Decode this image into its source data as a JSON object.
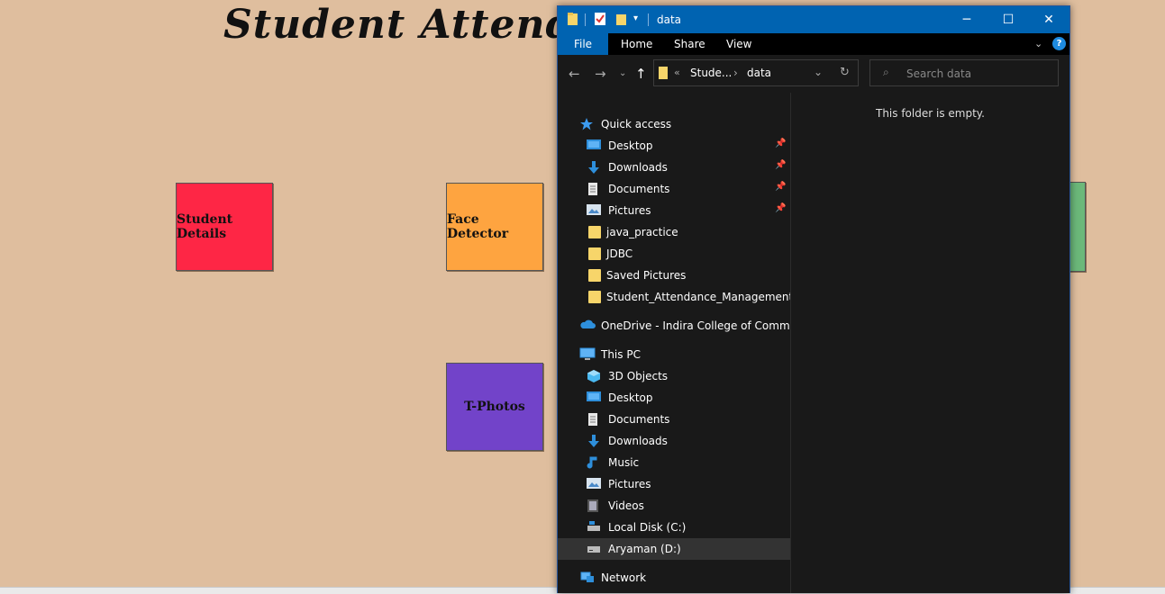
{
  "app": {
    "title": "Student Attendanc",
    "tiles": [
      {
        "label": "Student Details",
        "color": "#fe2645"
      },
      {
        "label": "Face Detector",
        "color": "#fea440"
      },
      {
        "label": "T-Photos",
        "color": "#7243c9"
      },
      {
        "label": "",
        "color": "#6cb87a"
      }
    ]
  },
  "explorer": {
    "title": "data",
    "window_controls": {
      "minimize": "─",
      "maximize": "☐",
      "close": "✕"
    },
    "ribbon_tabs": [
      "File",
      "Home",
      "Share",
      "View"
    ],
    "help": "?",
    "address": {
      "overflow": "«",
      "segments": [
        "Stude...",
        "data"
      ],
      "separator": "›"
    },
    "search": {
      "placeholder": "Search data"
    },
    "empty_message": "This folder is empty.",
    "nav": {
      "quick_access": "Quick access",
      "quick_items": [
        "Desktop",
        "Downloads",
        "Documents",
        "Pictures",
        "java_practice",
        "JDBC",
        "Saved Pictures",
        "Student_Attendance_Management_Sys"
      ],
      "onedrive": "OneDrive - Indira College of Commerce",
      "this_pc": "This PC",
      "pc_items": [
        "3D Objects",
        "Desktop",
        "Documents",
        "Downloads",
        "Music",
        "Pictures",
        "Videos",
        "Local Disk (C:)",
        "Aryaman (D:)"
      ],
      "network": "Network"
    },
    "colors": {
      "titlebar": "#0063b1",
      "background": "#191919"
    }
  }
}
